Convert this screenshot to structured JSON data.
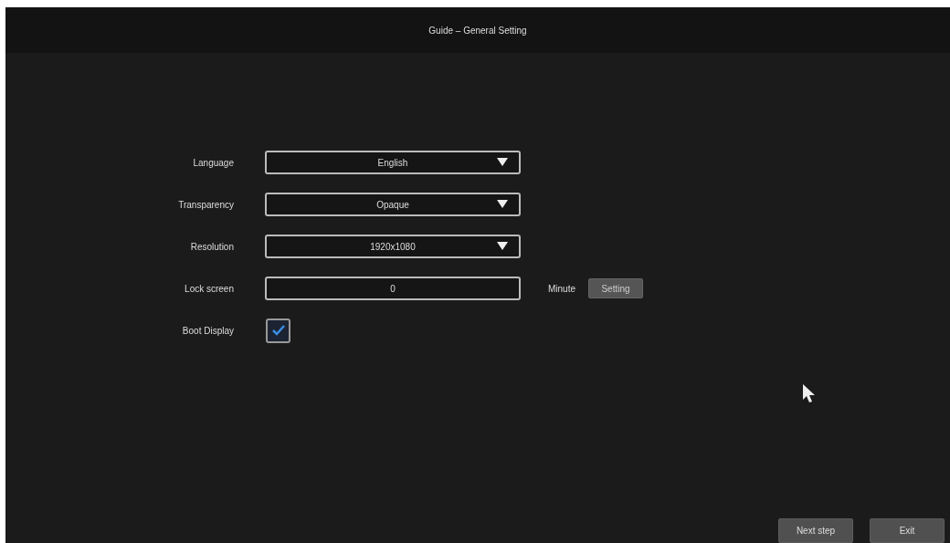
{
  "window": {
    "title": "Guide – General Setting"
  },
  "settings": [
    {
      "kind": "dropdown",
      "label": "Language",
      "value": "English"
    },
    {
      "kind": "dropdown",
      "label": "Transparency",
      "value": "Opaque"
    },
    {
      "kind": "dropdown",
      "label": "Resolution",
      "value": "1920x1080"
    },
    {
      "kind": "input",
      "label": "Lock screen",
      "value": "0",
      "unit": "Minute",
      "button": "Setting"
    },
    {
      "kind": "checkbox",
      "label": "Boot Display",
      "checked": true
    }
  ],
  "buttons": [
    "Next step",
    "Exit"
  ]
}
